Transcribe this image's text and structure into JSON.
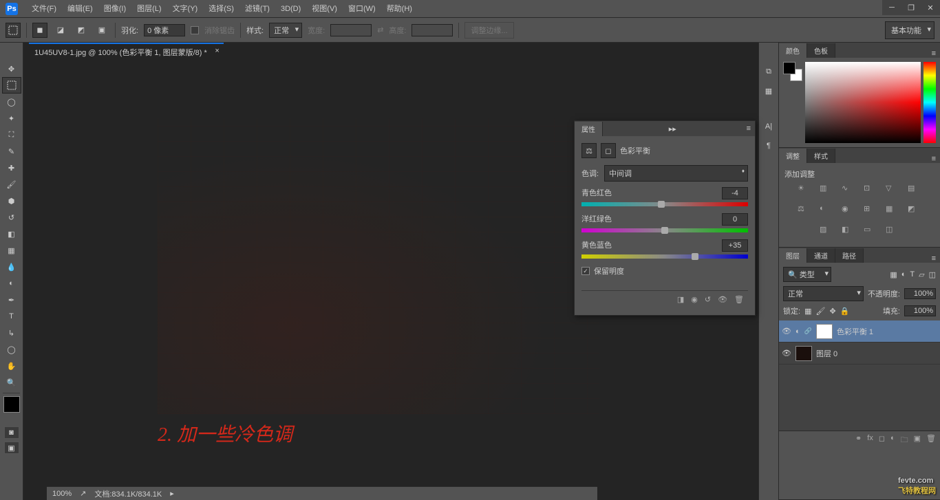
{
  "menubar": {
    "items": [
      "文件(F)",
      "编辑(E)",
      "图像(I)",
      "图层(L)",
      "文字(Y)",
      "选择(S)",
      "滤镜(T)",
      "3D(D)",
      "视图(V)",
      "窗口(W)",
      "帮助(H)"
    ]
  },
  "optionsbar": {
    "feather_label": "羽化:",
    "feather_value": "0 像素",
    "antialias": "消除锯齿",
    "style_label": "样式:",
    "style_value": "正常",
    "width_label": "宽度:",
    "height_label": "高度:",
    "refine_edge": "调整边缘...",
    "workspace": "基本功能"
  },
  "document": {
    "tab_title": "1U45UV8-1.jpg @ 100% (色彩平衡 1, 图层蒙版/8) *",
    "zoom": "100%",
    "doc_info": "文档:834.1K/834.1K"
  },
  "annotation_text": "2. 加一些冷色调",
  "properties": {
    "panel_title": "属性",
    "adjustment_name": "色彩平衡",
    "tone_label": "色调:",
    "tone_value": "中间调",
    "sliders": [
      {
        "left": "青色",
        "right": "红色",
        "value": "-4",
        "pos": 48
      },
      {
        "left": "洋红",
        "right": "绿色",
        "value": "0",
        "pos": 50
      },
      {
        "left": "黄色",
        "right": "蓝色",
        "value": "+35",
        "pos": 68
      }
    ],
    "preserve_lum": "保留明度"
  },
  "panels": {
    "color_tab": "颜色",
    "swatches_tab": "色板",
    "adjustments_tab": "调整",
    "styles_tab": "样式",
    "add_adjustment": "添加调整",
    "layers_tab": "图层",
    "channels_tab": "通道",
    "paths_tab": "路径"
  },
  "layers": {
    "kind_label": "类型",
    "blend_mode": "正常",
    "opacity_label": "不透明度:",
    "opacity_value": "100%",
    "lock_label": "锁定:",
    "fill_label": "填充:",
    "fill_value": "100%",
    "items": [
      {
        "name": "色彩平衡 1",
        "selected": true,
        "adjustment": true
      },
      {
        "name": "图层 0",
        "selected": false,
        "adjustment": false
      }
    ]
  },
  "watermark": {
    "main": "fevte.com",
    "sub": "飞特教程网"
  }
}
